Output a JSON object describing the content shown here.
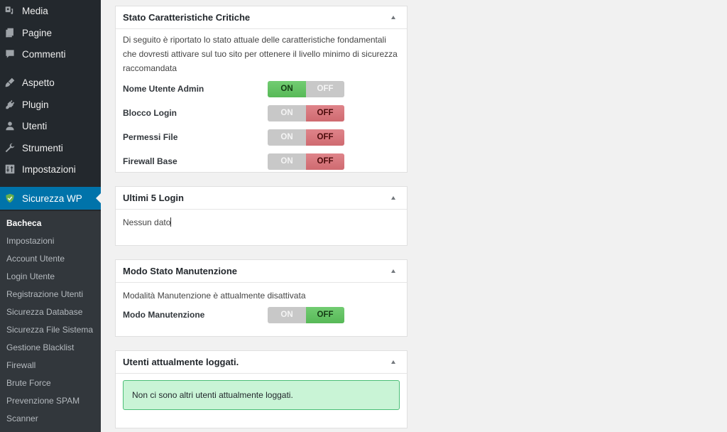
{
  "sidebar": {
    "menu": [
      {
        "label": "Media",
        "icon": "media-icon"
      },
      {
        "label": "Pagine",
        "icon": "pages-icon"
      },
      {
        "label": "Commenti",
        "icon": "comments-icon"
      },
      {
        "label": "Aspetto",
        "icon": "appearance-icon"
      },
      {
        "label": "Plugin",
        "icon": "plugin-icon"
      },
      {
        "label": "Utenti",
        "icon": "users-icon"
      },
      {
        "label": "Strumenti",
        "icon": "tools-icon"
      },
      {
        "label": "Impostazioni",
        "icon": "settings-icon"
      },
      {
        "label": "Sicurezza WP",
        "icon": "shield-icon"
      }
    ],
    "submenu": [
      {
        "label": "Bacheca"
      },
      {
        "label": "Impostazioni"
      },
      {
        "label": "Account Utente"
      },
      {
        "label": "Login Utente"
      },
      {
        "label": "Registrazione Utenti"
      },
      {
        "label": "Sicurezza Database"
      },
      {
        "label": "Sicurezza File Sistema"
      },
      {
        "label": "Gestione Blacklist"
      },
      {
        "label": "Firewall"
      },
      {
        "label": "Brute Force"
      },
      {
        "label": "Prevenzione SPAM"
      },
      {
        "label": "Scanner"
      }
    ]
  },
  "panels": {
    "critical": {
      "title": "Stato Caratteristiche Critiche",
      "description": "Di seguito è riportato lo stato attuale delle caratteristiche fondamentali che dovresti attivare sul tuo sito per ottenere il livello minimo di sicurezza raccomandata",
      "rows": [
        {
          "label": "Nome Utente Admin",
          "on": "ON",
          "off": "OFF",
          "state": "on"
        },
        {
          "label": "Blocco Login",
          "on": "ON",
          "off": "OFF",
          "state": "off"
        },
        {
          "label": "Permessi File",
          "on": "ON",
          "off": "OFF",
          "state": "off"
        },
        {
          "label": "Firewall Base",
          "on": "ON",
          "off": "OFF",
          "state": "off"
        }
      ]
    },
    "logins": {
      "title": "Ultimi 5 Login",
      "text": "Nessun dato"
    },
    "maintenance": {
      "title": "Modo Stato Manutenzione",
      "text": "Modalità Manutenzione è attualmente disattivata",
      "row": {
        "label": "Modo Manutenzione",
        "on": "ON",
        "off": "OFF",
        "state": "off"
      }
    },
    "logged": {
      "title": "Utenti attualmente loggati.",
      "notice": "Non ci sono altri utenti attualmente loggati."
    }
  },
  "colors": {
    "sidebar_bg": "#23282d",
    "submenu_bg": "#32373c",
    "active_bg": "#0073aa",
    "switch_on_green": "#62c462",
    "switch_off_red": "#d9737a",
    "notice_bg": "#c9f4d6"
  }
}
